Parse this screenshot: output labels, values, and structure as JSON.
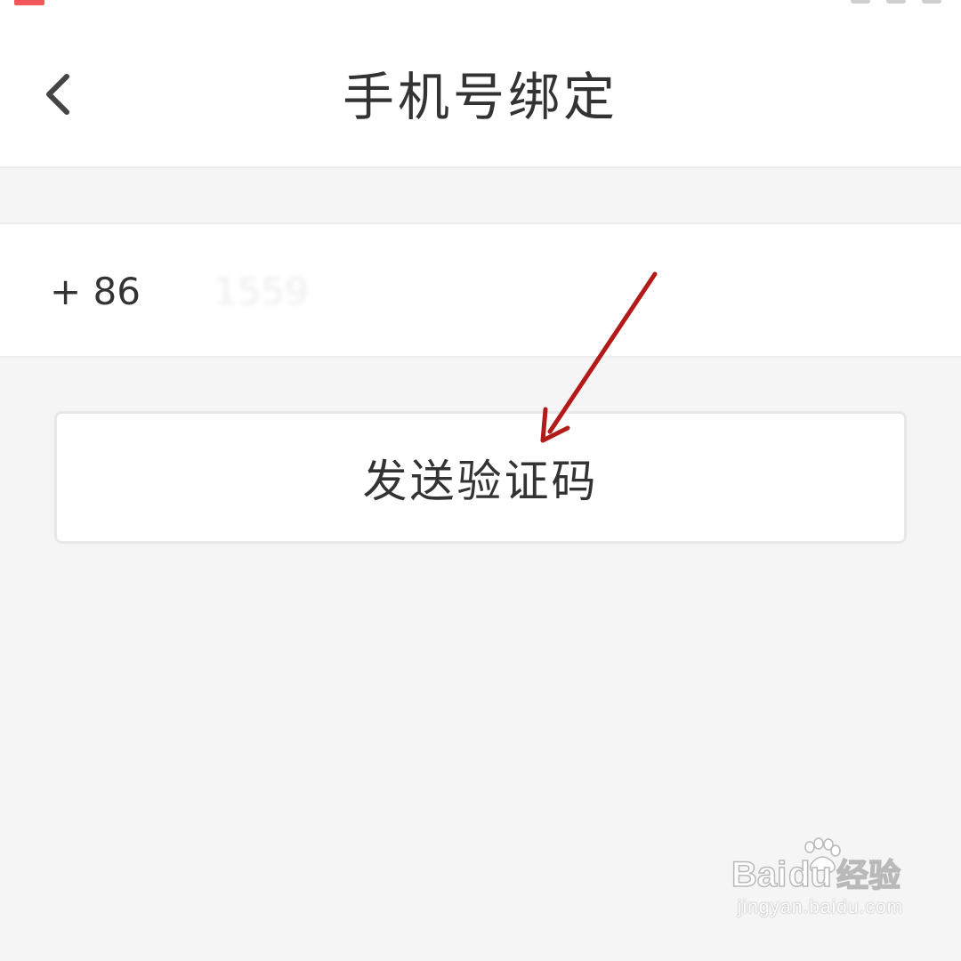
{
  "header": {
    "title": "手机号绑定",
    "back_icon": "chevron-left-icon"
  },
  "phone": {
    "country_code": "+ 86",
    "value": "1559"
  },
  "actions": {
    "send_code_label": "发送验证码"
  },
  "annotation": {
    "arrow_color": "#b31b1b"
  },
  "watermark": {
    "brand": "Bai经验",
    "url": "jingyan.baidu.com"
  },
  "colors": {
    "background": "#f5f5f5",
    "surface": "#ffffff",
    "text": "#333333",
    "divider": "#ececec"
  }
}
